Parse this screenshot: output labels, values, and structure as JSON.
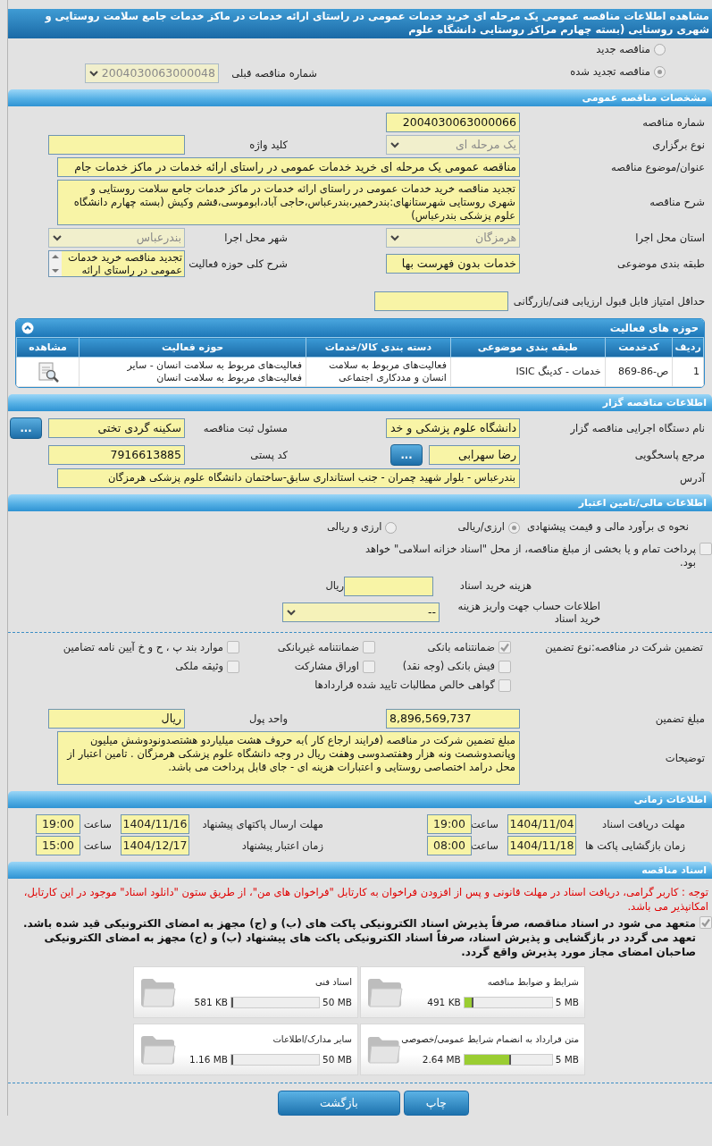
{
  "title": "مشاهده اطلاعات مناقصه عمومی یک مرحله ای خرید خدمات عمومی در راستای ارائه خدمات در ماکز خدمات جامع سلامت روستایی و شهری روستایی (بسته چهارم مراکز روستایی دانشگاه علوم",
  "tender_type": {
    "options": [
      {
        "label": "مناقصه جدید",
        "selected": false
      },
      {
        "label": "مناقصه تجدید شده",
        "selected": true
      }
    ],
    "previous": {
      "label": "شماره مناقصه قبلی",
      "value": "2004030063000048",
      "kind": "select",
      "disabled": true
    }
  },
  "general": {
    "heading": "مشخصات مناقصه عمومی",
    "rows": [
      {
        "right": {
          "label": "شماره مناقصه",
          "value": "2004030063000066",
          "kind": "text"
        }
      },
      {
        "right": {
          "label": "نوع برگزاری",
          "value": "یک مرحله ای",
          "kind": "select",
          "disabled": true
        },
        "left": {
          "label": "کلید واژه",
          "kind": "text"
        }
      },
      {
        "full": {
          "label": "عنوان/موضوع مناقصه",
          "value": "مناقصه عمومی یک مرحله ای خرید خدمات عمومی در راستای ارائه خدمات در ماکز خدمات جام",
          "kind": "text"
        }
      },
      {
        "full": {
          "label": "شرح مناقصه",
          "value": "تجدید مناقصه خرید خدمات عمومی در راستای ارائه خدمات در ماکز خدمات جامع سلامت روستایی و شهری روستایی شهرستانهای:بندرخمیر،بندرعباس،حاجی آباد،ابوموسی،قشم وکیش (بسته چهارم  دانشگاه علوم پزشکی بندرعباس)",
          "kind": "textarea"
        }
      },
      {
        "right": {
          "label": "استان محل اجرا",
          "value": "هرمزگان",
          "kind": "select",
          "disabled": true
        },
        "left": {
          "label": "شهر محل اجرا",
          "value": "بندرعباس",
          "kind": "select",
          "disabled": true
        }
      },
      {
        "right": {
          "label": "طبقه بندی موضوعی",
          "value": "خدمات بدون فهرست بها",
          "kind": "text"
        },
        "left": {
          "label": "شرح کلی حوزه فعالیت",
          "value": "تجدید مناقصه خرید خدمات عمومی در راستای ارائه",
          "kind": "scroll"
        }
      },
      {
        "right": {
          "label": "حداقل امتیاز قابل قبول ارزیابی فنی/بازرگانی",
          "kind": "text"
        }
      }
    ]
  },
  "activities": {
    "heading": "حوزه های فعالیت",
    "expanded": true,
    "columns": [
      "ردیف",
      "کدخدمت",
      "طبقه بندی موضوعی",
      "دسته بندی کالا/خدمات",
      "حوزه فعالیت",
      "مشاهده"
    ],
    "rows": [
      {
        "cells": [
          "1",
          "ص-86-869",
          "خدمات - کدینگ ISIC",
          "فعالیت‌های مربوط به سلامت انسان و مددکاری اجتماعی",
          "فعالیت‌های مربوط به سلامت انسان - سایر فعالیت‌های مربوط به سلامت انسان"
        ]
      }
    ]
  },
  "grantor": {
    "heading": "اطلاعات مناقصه گزار",
    "rows": [
      {
        "right": {
          "label": "نام دستگاه اجرایی مناقصه گزار",
          "value": "دانشگاه علوم پزشکی و خد",
          "kind": "text"
        },
        "left": {
          "label": "مسئول ثبت مناقصه",
          "value": "سکینه گردی تختی",
          "kind": "text",
          "button": "..."
        }
      },
      {
        "right": {
          "label": "مرجع پاسخگویی",
          "value": "رضا سهرابی",
          "kind": "text",
          "button": "..."
        },
        "left": {
          "label": "کد پستی",
          "value": "7916613885",
          "kind": "text"
        }
      },
      {
        "full": {
          "label": "آدرس",
          "value": "بندرعباس - بلوار شهید چمران - جنب استانداری سابق-ساختمان دانشگاه علوم پزشکی هرمزگان",
          "kind": "textarea"
        }
      }
    ]
  },
  "finance": {
    "heading": "اطلاعات مالی/تامین اعتبار",
    "estimate": {
      "label": "نحوه ی برآورد مالی و قیمت پیشنهادی",
      "options": [
        {
          "label": "ارزی/ریالی",
          "selected": true
        },
        {
          "label": "ارزی و ریالی",
          "selected": false
        }
      ]
    },
    "treasury": {
      "label": "پرداخت تمام و یا بخشی از مبلغ مناقصه، از محل \"اسناد خزانه اسلامی\" خواهد بود.",
      "checked": false
    },
    "fee": {
      "label": "هزینه خرید اسناد",
      "unit": "ریال"
    },
    "account": {
      "label": "اطلاعات حساب جهت واریز هزینه خرید اسناد",
      "value": "--",
      "kind": "select",
      "disabled": false
    }
  },
  "guarantee": {
    "label": "تضمین شرکت در مناقصه:",
    "type_label": "نوع تضمین",
    "options": [
      {
        "label": "ضمانتنامه بانکی",
        "checked": true
      },
      {
        "label": "ضمانتنامه غیربانکی",
        "checked": false
      },
      {
        "label": "موارد بند پ ، ح و خ آیین نامه تضامین",
        "checked": false
      },
      {
        "label": "فیش بانکی (وجه نقد)",
        "checked": false
      },
      {
        "label": "اوراق مشارکت",
        "checked": false
      },
      {
        "label": "وثیقه ملکی",
        "checked": false
      },
      {
        "label": "گواهی خالص مطالبات تایید شده قراردادها",
        "checked": false
      }
    ],
    "rows": [
      {
        "right": {
          "label": "مبلغ تضمین",
          "value": "8,896,569,737",
          "kind": "text"
        },
        "left": {
          "label": "واحد پول",
          "value": "ریال",
          "kind": "text"
        }
      },
      {
        "full": {
          "label": "توضیحات",
          "value": "مبلغ تضمین شرکت در مناقصه (فرایند ارجاع کار )به حروف هشت میلیاردو هشتصدونودوشش میلیون وپانصدوشصت ونه هزار وهفتصدوسی وهفت ریال در وجه دانشگاه علوم پزشکی هرمزگان . تامین اعتبار از محل درامد اختصاصی روستایی و اعتبارات هزینه ای - جای قابل پرداخت می باشد.",
          "kind": "textarea"
        }
      }
    ]
  },
  "timing": {
    "heading": "اطلاعات زمانی",
    "rows": [
      {
        "right": {
          "label": "مهلت دریافت اسناد",
          "date": "1404/11/04",
          "time_label": "ساعت",
          "time": "19:00"
        },
        "left": {
          "label": "مهلت ارسال پاکتهای پیشنهاد",
          "date": "1404/11/16",
          "time_label": "ساعت",
          "time": "19:00"
        }
      },
      {
        "right": {
          "label": "زمان بازگشایی پاکت ها",
          "date": "1404/11/18",
          "time_label": "ساعت",
          "time": "08:00"
        },
        "left": {
          "label": "زمان اعتبار پیشنهاد",
          "date": "1404/12/17",
          "time_label": "ساعت",
          "time": "15:00"
        }
      }
    ]
  },
  "documents": {
    "heading": "اسناد مناقصه",
    "notice": "توجه : کاربر گرامی، دریافت اسناد در مهلت قانونی و پس از افزودن فراخوان به کارتابل \"فراخوان های من\"، از طریق ستون \"دانلود اسناد\" موجود در این کارتابل، امکانپذیر می باشد.",
    "commitment": {
      "text": "متعهد می شود در اسناد مناقصه، صرفاً پذیرش اسناد الکترونیکی پاکت های (ب) و (ج) مجهز به امضای الکترونیکی قید شده باشد. تعهد می گردد در بازگشایی و پذیرش اسناد، صرفاً اسناد الکترونیکی پاکت های پیشنهاد (ب) و (ج) مجهز به امضای الکترونیکی صاحبان امضای مجاز مورد پذیرش واقع گردد.",
      "checked": true
    },
    "files": [
      {
        "title": "شرایط و ضوابط مناقصه",
        "limit": "5 MB",
        "size": "491 KB",
        "level": 0.1
      },
      {
        "title": "اسناد فنی",
        "limit": "50 MB",
        "size": "581 KB",
        "level": 0.012
      },
      {
        "title": "متن قرارداد به انضمام شرایط عمومی/خصوصی",
        "limit": "5 MB",
        "size": "2.64 MB",
        "level": 0.53
      },
      {
        "title": "سایر مدارک/اطلاعات",
        "limit": "50 MB",
        "size": "1.16 MB",
        "level": 0.023
      }
    ]
  },
  "buttons": [
    "چاپ",
    "بازگشت"
  ]
}
